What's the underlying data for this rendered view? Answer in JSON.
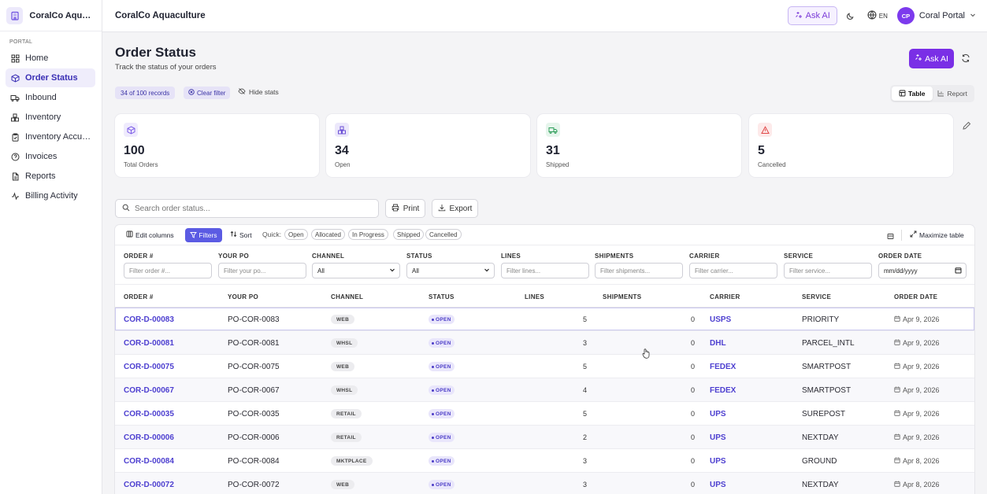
{
  "app": {
    "name": "CoralCo Aquac...",
    "title": "CoralCo Aquaculture"
  },
  "sidebar": {
    "section": "PORTAL",
    "items": [
      {
        "label": "Home",
        "icon": "grid-icon"
      },
      {
        "label": "Order Status",
        "icon": "box-icon",
        "active": true
      },
      {
        "label": "Inbound",
        "icon": "truck-icon"
      },
      {
        "label": "Inventory",
        "icon": "boxes-icon"
      },
      {
        "label": "Inventory Accura...",
        "icon": "clipboard-check-icon"
      },
      {
        "label": "Invoices",
        "icon": "help-circle-icon"
      },
      {
        "label": "Reports",
        "icon": "file-icon"
      },
      {
        "label": "Billing Activity",
        "icon": "activity-icon"
      }
    ]
  },
  "topbar": {
    "ask_ai": "Ask AI",
    "lang": "EN",
    "avatar_initials": "CP",
    "user_name": "Coral Portal"
  },
  "page": {
    "title": "Order Status",
    "subtitle": "Track the status of your orders",
    "ask_ai": "Ask AI",
    "records_chip": "34 of 100 records",
    "clear_filter": "Clear filter",
    "hide_stats": "Hide stats",
    "view_table": "Table",
    "view_report": "Report"
  },
  "stats": [
    {
      "value": "100",
      "label": "Total Orders",
      "icon": "box-icon",
      "color": "#7c5ce6",
      "bg": "#efebfd"
    },
    {
      "value": "34",
      "label": "Open",
      "icon": "boxes-icon",
      "color": "#6b4fd6",
      "bg": "#ece8fb"
    },
    {
      "value": "31",
      "label": "Shipped",
      "icon": "truck-icon",
      "color": "#2f9e5a",
      "bg": "#e6f5ec"
    },
    {
      "value": "5",
      "label": "Cancelled",
      "icon": "alert-triangle-icon",
      "color": "#e04848",
      "bg": "#fdeaea"
    }
  ],
  "toolbar": {
    "search_placeholder": "Search order status...",
    "print": "Print",
    "export": "Export"
  },
  "table_toolbar": {
    "edit_columns": "Edit columns",
    "filters": "Filters",
    "sort": "Sort",
    "quick": "Quick:",
    "quick_chips": [
      "Open",
      "Allocated",
      "In Progress",
      "Shipped",
      "Cancelled"
    ],
    "maximize": "Maximize table"
  },
  "filters": {
    "headers": [
      "ORDER #",
      "YOUR PO",
      "CHANNEL",
      "STATUS",
      "LINES",
      "SHIPMENTS",
      "CARRIER",
      "SERVICE",
      "ORDER DATE"
    ],
    "placeholders": [
      "Filter order #...",
      "Filter your po...",
      "All",
      "All",
      "Filter lines...",
      "Filter shipments...",
      "Filter carrier...",
      "Filter service...",
      "mm/dd/yyyy"
    ]
  },
  "columns": [
    "ORDER #",
    "YOUR PO",
    "CHANNEL",
    "STATUS",
    "LINES",
    "SHIPMENTS",
    "CARRIER",
    "SERVICE",
    "ORDER DATE"
  ],
  "rows": [
    {
      "order": "COR-D-00083",
      "po": "PO-COR-0083",
      "channel": "WEB",
      "status": "OPEN",
      "lines": "5",
      "shipments": "0",
      "carrier": "USPS",
      "service": "PRIORITY",
      "date": "Apr 9, 2026"
    },
    {
      "order": "COR-D-00081",
      "po": "PO-COR-0081",
      "channel": "WHSL",
      "status": "OPEN",
      "lines": "3",
      "shipments": "0",
      "carrier": "DHL",
      "service": "PARCEL_INTL",
      "date": "Apr 9, 2026"
    },
    {
      "order": "COR-D-00075",
      "po": "PO-COR-0075",
      "channel": "WEB",
      "status": "OPEN",
      "lines": "5",
      "shipments": "0",
      "carrier": "FEDEX",
      "service": "SMARTPOST",
      "date": "Apr 9, 2026"
    },
    {
      "order": "COR-D-00067",
      "po": "PO-COR-0067",
      "channel": "WHSL",
      "status": "OPEN",
      "lines": "4",
      "shipments": "0",
      "carrier": "FEDEX",
      "service": "SMARTPOST",
      "date": "Apr 9, 2026"
    },
    {
      "order": "COR-D-00035",
      "po": "PO-COR-0035",
      "channel": "RETAIL",
      "status": "OPEN",
      "lines": "5",
      "shipments": "0",
      "carrier": "UPS",
      "service": "SUREPOST",
      "date": "Apr 9, 2026"
    },
    {
      "order": "COR-D-00006",
      "po": "PO-COR-0006",
      "channel": "RETAIL",
      "status": "OPEN",
      "lines": "2",
      "shipments": "0",
      "carrier": "UPS",
      "service": "NEXTDAY",
      "date": "Apr 9, 2026"
    },
    {
      "order": "COR-D-00084",
      "po": "PO-COR-0084",
      "channel": "MKTPLACE",
      "status": "OPEN",
      "lines": "3",
      "shipments": "0",
      "carrier": "UPS",
      "service": "GROUND",
      "date": "Apr 8, 2026"
    },
    {
      "order": "COR-D-00072",
      "po": "PO-COR-0072",
      "channel": "WEB",
      "status": "OPEN",
      "lines": "3",
      "shipments": "0",
      "carrier": "UPS",
      "service": "NEXTDAY",
      "date": "Apr 8, 2026"
    }
  ]
}
